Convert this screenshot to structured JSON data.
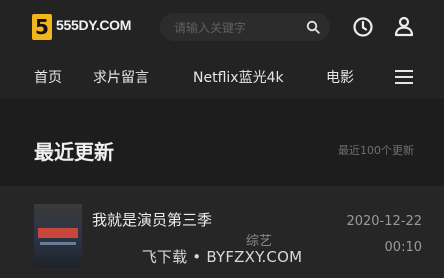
{
  "header": {
    "logo_badge": "5",
    "logo_text": "555DY.COM",
    "search_placeholder": "请输入关键字"
  },
  "nav": {
    "items": [
      {
        "label": "首页"
      },
      {
        "label": "求片留言"
      },
      {
        "label": "Netflix蓝光4k"
      },
      {
        "label": "电影"
      }
    ]
  },
  "section": {
    "title": "最近更新",
    "more": "最近100个更新"
  },
  "list": {
    "items": [
      {
        "title": "我就是演员第三季",
        "tag": "综艺",
        "date": "2020-12-22",
        "time": "00:10"
      }
    ]
  },
  "watermark": "飞下载 • BYFZXY.COM",
  "icons": {
    "logo": "5-badge",
    "search": "search-icon",
    "history": "clock-icon",
    "user": "user-icon",
    "menu": "menu-icon"
  },
  "colors": {
    "background": "#1d1d1d",
    "header": "#232323",
    "logo_accent": "#f0b51f"
  }
}
